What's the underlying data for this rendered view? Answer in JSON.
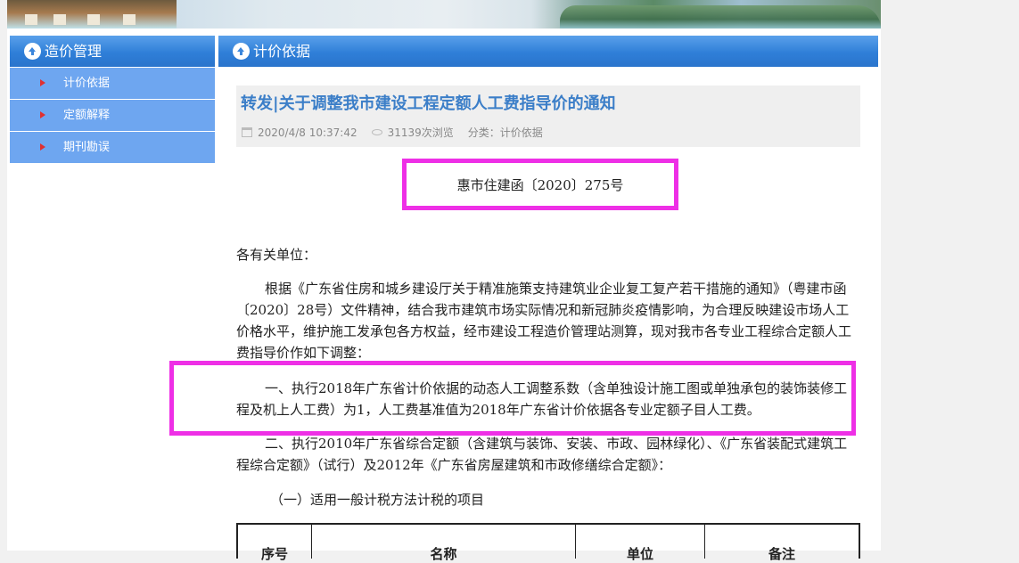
{
  "sidebar": {
    "title": "造价管理",
    "items": [
      {
        "label": "计价依据"
      },
      {
        "label": "定额解释"
      },
      {
        "label": "期刊勘误"
      }
    ]
  },
  "main": {
    "section_title": "计价依据",
    "article": {
      "title": "转发|关于调整我市建设工程定额人工费指导价的通知",
      "date": "2020/4/8 10:37:42",
      "views": "31139次浏览",
      "category": "分类：计价依据"
    },
    "doc_number": "惠市住建函〔2020〕275号",
    "salutation": "各有关单位：",
    "para1": "根据《广东省住房和城乡建设厅关于精准施策支持建筑业企业复工复产若干措施的通知》（粤建市函〔2020〕28号）文件精神，结合我市建筑市场实际情况和新冠肺炎疫情影响，为合理反映建设市场人工价格水平，维护施工发承包各方权益，经市建设工程造价管理站测算，现对我市各专业工程综合定额人工费指导价作如下调整：",
    "para2": "一、执行2018年广东省计价依据的动态人工调整系数（含单独设计施工图或单独承包的装饰装修工程及机上人工费）为1，人工费基准值为2018年广东省计价依据各专业定额子目人工费。",
    "para3": "二、执行2010年广东省综合定额（含建筑与装饰、安装、市政、园林绿化）、《广东省装配式建筑工程综合定额》（试行）及2012年《广东省房屋建筑和市政修缮综合定额》：",
    "para4": "（一）适用一般计税方法计税的项目",
    "table_headers": [
      "序号",
      "名称",
      "单位",
      "备注"
    ]
  },
  "colors": {
    "header_blue": "#2f7fd8",
    "sidebar_item": "#6ea6f0",
    "title_blue": "#3b7ec8",
    "highlight_magenta": "#ee2fe6"
  }
}
